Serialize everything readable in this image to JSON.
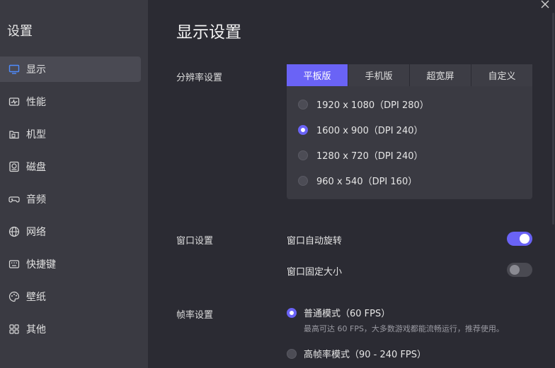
{
  "sidebar": {
    "title": "设置",
    "items": [
      {
        "label": "显示",
        "icon": "monitor-icon",
        "active": true
      },
      {
        "label": "性能",
        "icon": "performance-icon"
      },
      {
        "label": "机型",
        "icon": "device-model-icon"
      },
      {
        "label": "磁盘",
        "icon": "disk-icon"
      },
      {
        "label": "音频",
        "icon": "gamepad-audio-icon"
      },
      {
        "label": "网络",
        "icon": "globe-icon"
      },
      {
        "label": "快捷键",
        "icon": "keyboard-icon"
      },
      {
        "label": "壁纸",
        "icon": "palette-icon"
      },
      {
        "label": "其他",
        "icon": "grid-icon"
      }
    ]
  },
  "main": {
    "title": "显示设置",
    "resolution": {
      "label": "分辨率设置",
      "tabs": [
        "平板版",
        "手机版",
        "超宽屏",
        "自定义"
      ],
      "active_tab": 0,
      "options": [
        {
          "label": "1920 x 1080（DPI 280）",
          "selected": false
        },
        {
          "label": "1600 x 900（DPI 240）",
          "selected": true
        },
        {
          "label": "1280 x 720（DPI 240）",
          "selected": false
        },
        {
          "label": "960 x 540（DPI 160）",
          "selected": false
        }
      ]
    },
    "window": {
      "label": "窗口设置",
      "auto_rotate_label": "窗口自动旋转",
      "auto_rotate_on": true,
      "fixed_size_label": "窗口固定大小",
      "fixed_size_on": false
    },
    "framerate": {
      "label": "帧率设置",
      "normal_label": "普通模式（60 FPS）",
      "normal_selected": true,
      "normal_hint": "最高可达 60 FPS，大多数游戏都能流畅运行，推荐使用。",
      "high_label": "高帧率模式（90 - 240 FPS）",
      "high_selected": false
    }
  },
  "colors": {
    "accent": "#6a63f6",
    "sidebar_bg": "#3a3a42",
    "main_bg": "#2b2b33"
  }
}
